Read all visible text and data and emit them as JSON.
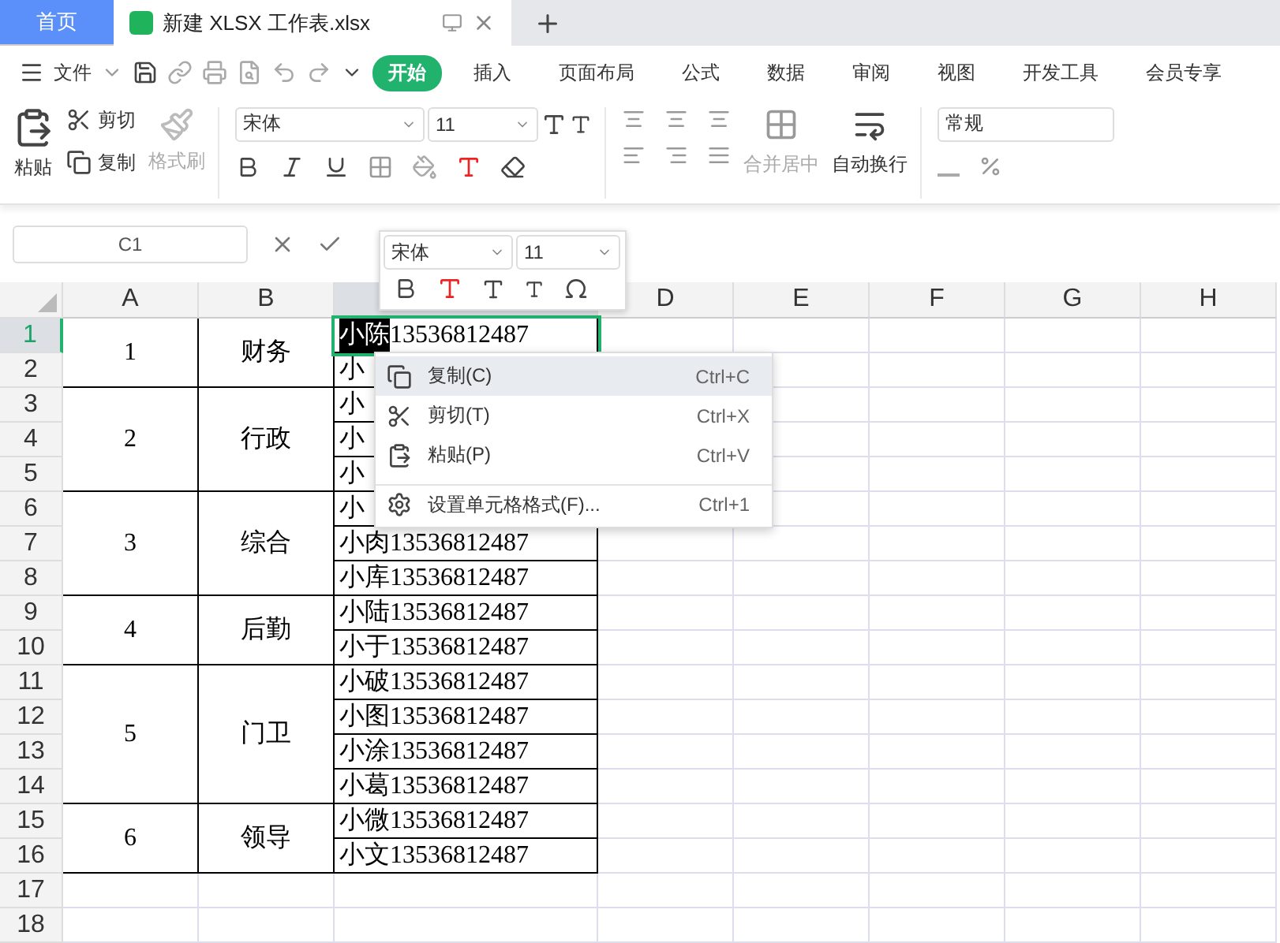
{
  "tabs": [
    {
      "label": "首页",
      "kind": "home",
      "selected": false
    },
    {
      "label": "新建 XLSX 工作表.xlsx",
      "kind": "doc",
      "selected": true
    }
  ],
  "menu": {
    "file": "文件",
    "tabs": [
      {
        "label": "开始",
        "selected": true
      },
      {
        "label": "插入",
        "selected": false
      },
      {
        "label": "页面布局",
        "selected": false
      },
      {
        "label": "公式",
        "selected": false
      },
      {
        "label": "数据",
        "selected": false
      },
      {
        "label": "审阅",
        "selected": false
      },
      {
        "label": "视图",
        "selected": false
      },
      {
        "label": "开发工具",
        "selected": false
      },
      {
        "label": "会员专享",
        "selected": false
      }
    ]
  },
  "ribbon": {
    "paste": "粘贴",
    "cut": "剪切",
    "copy": "复制",
    "format_painter": {
      "label": "格式刷",
      "disabled": true
    },
    "font": "宋体",
    "font_size": "11",
    "merge": {
      "label": "合并居中",
      "disabled": true
    },
    "wrap": {
      "label": "自动换行",
      "disabled": false
    },
    "number_format": "常规"
  },
  "formula_bar": {
    "name_box": "C1"
  },
  "mini_toolbar": {
    "font": "宋体",
    "font_size": "11"
  },
  "context_menu": [
    {
      "label": "复制(C)",
      "shortcut": "Ctrl+C",
      "kind": "copy",
      "selected": true
    },
    {
      "label": "剪切(T)",
      "shortcut": "Ctrl+X",
      "kind": "cut",
      "selected": false
    },
    {
      "label": "粘贴(P)",
      "shortcut": "Ctrl+V",
      "kind": "paste",
      "selected": false
    },
    {
      "label": "设置单元格格式(F)...",
      "shortcut": "Ctrl+1",
      "kind": "format",
      "selected": false
    }
  ],
  "sheet": {
    "columns": [
      {
        "label": "A",
        "selected": false
      },
      {
        "label": "B",
        "selected": false
      },
      {
        "selected": true
      },
      {
        "label": "D",
        "selected": false
      },
      {
        "label": "E",
        "selected": false
      },
      {
        "label": "F",
        "selected": false
      },
      {
        "label": "G",
        "selected": false
      },
      {
        "label": "H",
        "selected": false
      }
    ],
    "rows": [
      {
        "label": "1",
        "selected": true
      },
      {
        "label": "2",
        "selected": false
      },
      {
        "label": "3",
        "selected": false
      },
      {
        "label": "4",
        "selected": false
      },
      {
        "label": "5",
        "selected": false
      },
      {
        "label": "6",
        "selected": false
      },
      {
        "label": "7",
        "selected": false
      },
      {
        "label": "8",
        "selected": false
      },
      {
        "label": "9",
        "selected": false
      },
      {
        "label": "10",
        "selected": false
      },
      {
        "label": "11",
        "selected": false
      },
      {
        "label": "12",
        "selected": false
      },
      {
        "label": "13",
        "selected": false
      },
      {
        "label": "14",
        "selected": false
      },
      {
        "label": "15",
        "selected": false
      },
      {
        "label": "16",
        "selected": false
      },
      {
        "label": "17",
        "selected": false
      },
      {
        "label": "18",
        "selected": false
      }
    ],
    "groups": [
      {
        "number": "1",
        "department": "财务",
        "people": [
          {
            "highlighted": "小陈",
            "text": "13536812487"
          },
          {
            "text": "小"
          }
        ]
      },
      {
        "number": "2",
        "department": "行政",
        "people": [
          {
            "text": "小"
          },
          {
            "text": "小"
          },
          {
            "text": "小"
          }
        ]
      },
      {
        "number": "3",
        "department": "综合",
        "people": [
          {
            "text": "小"
          },
          {
            "text": "小肉13536812487"
          },
          {
            "text": "小库13536812487"
          }
        ]
      },
      {
        "number": "4",
        "department": "后勤",
        "people": [
          {
            "text": "小陆13536812487"
          },
          {
            "text": "小于13536812487"
          }
        ]
      },
      {
        "number": "5",
        "department": "门卫",
        "people": [
          {
            "text": "小破13536812487"
          },
          {
            "text": "小图13536812487"
          },
          {
            "text": "小涂13536812487"
          },
          {
            "text": "小葛13536812487"
          }
        ]
      },
      {
        "number": "6",
        "department": "领导",
        "people": [
          {
            "text": "小微13536812487"
          },
          {
            "text": "小文13536812487"
          }
        ]
      }
    ]
  }
}
